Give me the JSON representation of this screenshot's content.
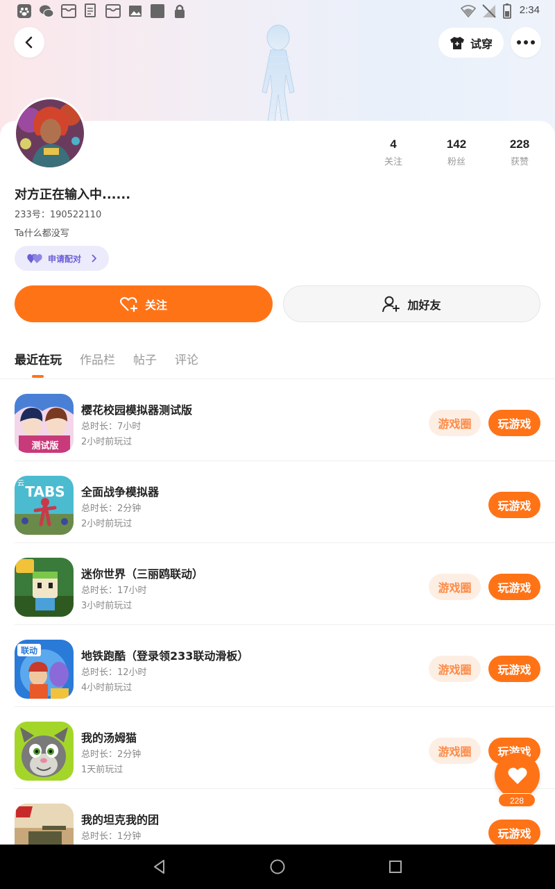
{
  "status_bar": {
    "time": "2:34"
  },
  "header": {
    "try_on_label": "试穿"
  },
  "profile": {
    "stats": [
      {
        "value": "4",
        "label": "关注"
      },
      {
        "value": "142",
        "label": "粉丝"
      },
      {
        "value": "228",
        "label": "获赞"
      }
    ],
    "name": "对方正在输入中......",
    "uid": "233号：190522110",
    "bio": "Ta什么都没写",
    "match_label": "申请配对"
  },
  "actions": {
    "follow_label": "关注",
    "add_friend_label": "加好友"
  },
  "tabs": [
    "最近在玩",
    "作品栏",
    "帖子",
    "评论"
  ],
  "games": [
    {
      "title": "樱花校园模拟器测试版",
      "duration": "总时长：7小时",
      "last_played": "2小时前玩过",
      "circle_label": "游戏圈",
      "play_label": "玩游戏",
      "has_circle": true
    },
    {
      "title": "全面战争模拟器",
      "duration": "总时长：2分钟",
      "last_played": "2小时前玩过",
      "circle_label": "",
      "play_label": "玩游戏",
      "has_circle": false
    },
    {
      "title": "迷你世界（三丽鸥联动）",
      "duration": "总时长：17小时",
      "last_played": "3小时前玩过",
      "circle_label": "游戏圈",
      "play_label": "玩游戏",
      "has_circle": true
    },
    {
      "title": "地铁跑酷（登录领233联动滑板）",
      "duration": "总时长：12小时",
      "last_played": "4小时前玩过",
      "circle_label": "游戏圈",
      "play_label": "玩游戏",
      "has_circle": true
    },
    {
      "title": "我的汤姆猫",
      "duration": "总时长：2分钟",
      "last_played": "1天前玩过",
      "circle_label": "游戏圈",
      "play_label": "玩游戏",
      "has_circle": true
    },
    {
      "title": "我的坦克我的团",
      "duration": "总时长：1分钟",
      "last_played": "",
      "circle_label": "",
      "play_label": "玩游戏",
      "has_circle": false
    }
  ],
  "like_fab": {
    "count": "228"
  },
  "game_icon_badges": {
    "game0": "测试版",
    "game1_tag": "云",
    "game1_logo": "TABS",
    "game3": "联动"
  },
  "colors": {
    "accent": "#ff7317",
    "circle_bg": "#fdeee4",
    "match_bg": "#ecebfb"
  }
}
